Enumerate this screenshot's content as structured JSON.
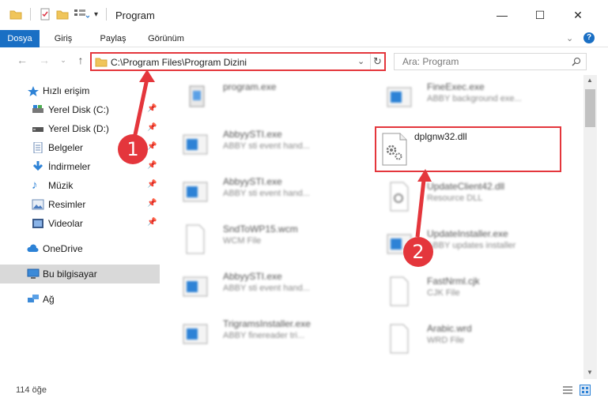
{
  "window": {
    "title": "Program"
  },
  "ribbon": {
    "tabs": [
      "Dosya",
      "Giriş",
      "Paylaş",
      "Görünüm"
    ]
  },
  "address": {
    "path": "C:\\Program Files\\Program Dizini"
  },
  "search": {
    "placeholder": "Ara: Program"
  },
  "sidebar": {
    "items": [
      {
        "label": "Hızlı erişim"
      },
      {
        "label": "Yerel Disk (C:)"
      },
      {
        "label": "Yerel Disk (D:)"
      },
      {
        "label": "Belgeler"
      },
      {
        "label": "İndirmeler"
      },
      {
        "label": "Müzik"
      },
      {
        "label": "Resimler"
      },
      {
        "label": "Videolar"
      },
      {
        "label": "OneDrive"
      },
      {
        "label": "Bu bilgisayar"
      },
      {
        "label": "Ağ"
      }
    ]
  },
  "files": [
    {
      "name": "program.exe",
      "type": ""
    },
    {
      "name": "FineExec.exe",
      "type": "ABBY background exe..."
    },
    {
      "name": "AbbyySTI.exe",
      "type": "ABBY sti event hand..."
    },
    {
      "name": "dplgnw32.dll",
      "type": ""
    },
    {
      "name": "AbbyySTI.exe",
      "type": "ABBY sti event hand..."
    },
    {
      "name": "UpdateClient42.dll",
      "type": "Resource DLL"
    },
    {
      "name": "SndToWP15.wcm",
      "type": "WCM File"
    },
    {
      "name": "UpdateInstaller.exe",
      "type": "ABBY updates installer"
    },
    {
      "name": "AbbyySTI.exe",
      "type": "ABBY sti event hand..."
    },
    {
      "name": "FastNrml.cjk",
      "type": "CJK File"
    },
    {
      "name": "TrigramsInstaller.exe",
      "type": "ABBY finereader tri..."
    },
    {
      "name": "Arabic.wrd",
      "type": "WRD File"
    }
  ],
  "status": {
    "count": "114 öğe"
  },
  "annotations": {
    "badge1": "1",
    "badge2": "2"
  },
  "colors": {
    "accent": "#1a6fc4",
    "highlight": "#e4363c"
  }
}
